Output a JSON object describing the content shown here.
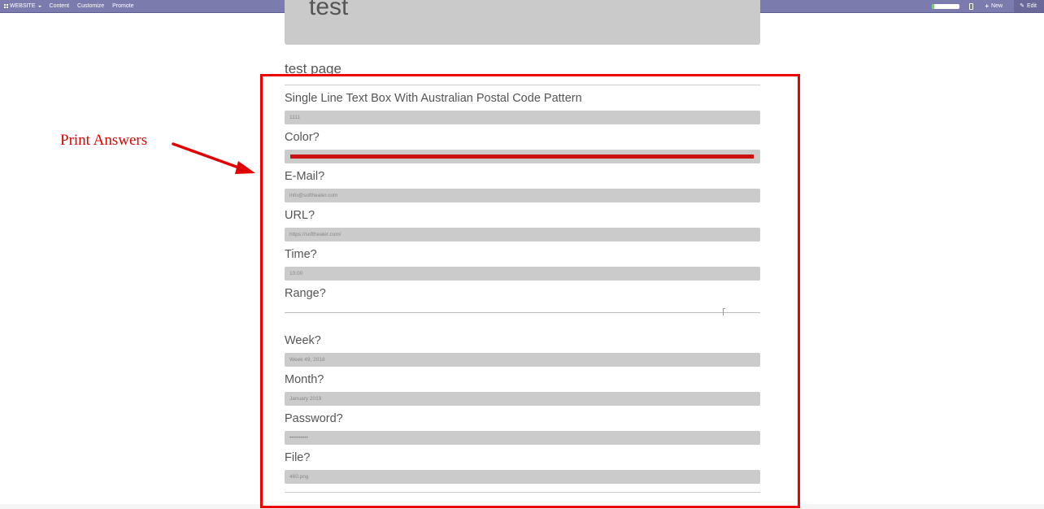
{
  "navbar": {
    "website_label": "WEBSITE",
    "content_label": "Content",
    "customize_label": "Customize",
    "promote_label": "Promote",
    "new_label": "New",
    "edit_label": "Edit",
    "progress_fraction": 0.08
  },
  "banner": {
    "title": "test"
  },
  "page": {
    "title": "test page"
  },
  "questions": {
    "postal": {
      "label": "Single Line Text Box With Australian Postal Code Pattern",
      "answer": "1111"
    },
    "color": {
      "label": "Color?",
      "answer_color": "#cc1111"
    },
    "email": {
      "label": "E-Mail?",
      "answer": "info@softhealer.com"
    },
    "url": {
      "label": "URL?",
      "answer": "https://softhealer.com/"
    },
    "time": {
      "label": "Time?",
      "answer": "10:00"
    },
    "range": {
      "label": "Range?",
      "value_fraction": 0.92
    },
    "week": {
      "label": "Week?",
      "answer": "Week 49, 2018"
    },
    "month": {
      "label": "Month?",
      "answer": "January 2019"
    },
    "password": {
      "label": "Password?",
      "answer": "••••••••••"
    },
    "file": {
      "label": "File?",
      "answer": "460.png"
    }
  },
  "annotation": {
    "label": "Print Answers",
    "highlight_color": "#ee0000"
  }
}
